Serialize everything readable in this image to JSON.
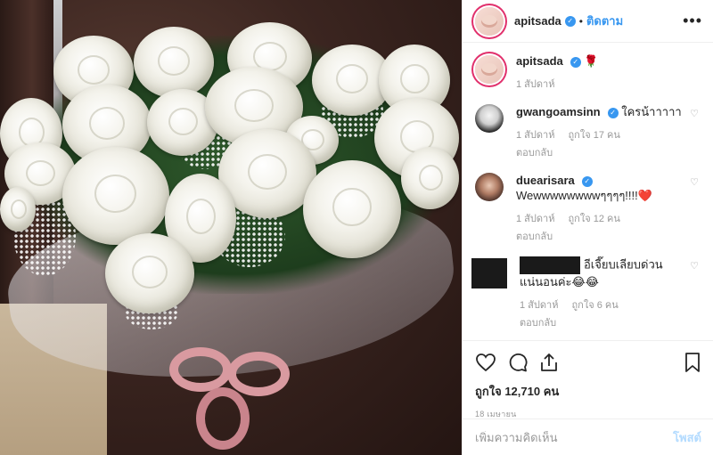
{
  "header": {
    "username": "apitsada",
    "separator": "•",
    "follow_label": "ติดตาม",
    "more_label": "•••"
  },
  "caption": {
    "username": "apitsada",
    "emoji": "🌹",
    "time": "1 สัปดาห์"
  },
  "comments": [
    {
      "username": "gwangoamsinn",
      "text": "ใครน้าาาาา",
      "time": "1 สัปดาห์",
      "likes": "ถูกใจ 17 คน",
      "reply": "ตอบกลับ"
    },
    {
      "username": "duearisara",
      "text": "Wewwwwwwwwๆๆๆๆ!!!!❤️",
      "time": "1 สัปดาห์",
      "likes": "ถูกใจ 12 คน",
      "reply": "ตอบกลับ"
    },
    {
      "username": "",
      "text": "อีเจี๊ยบเลียบด่วนแน่นอนค่ะ😂😂",
      "time": "1 สัปดาห์",
      "likes": "ถูกใจ 6 คน",
      "reply": "ตอบกลับ"
    }
  ],
  "actions": {
    "likes": "ถูกใจ 12,710 คน",
    "date": "18 เมษายน"
  },
  "add_comment": {
    "placeholder": "เพิ่มความคิดเห็น",
    "post_label": "โพสต์"
  },
  "icons": [
    "heart-icon",
    "comment-icon",
    "share-icon",
    "bookmark-icon",
    "verified-icon"
  ],
  "colors": {
    "accent": "#3897f0",
    "muted": "#999999",
    "post_disabled": "#b3dbff"
  }
}
